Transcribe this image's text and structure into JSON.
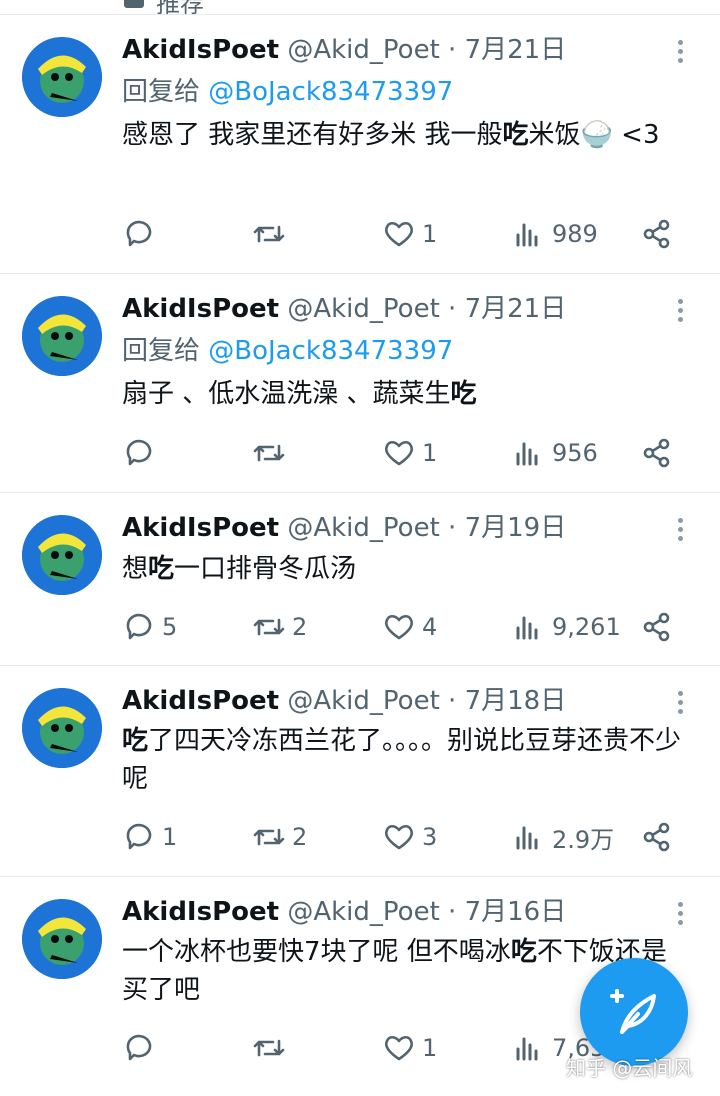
{
  "top": {
    "label": "推荐"
  },
  "tweets": [
    {
      "name": "AkidIsPoet",
      "handle": "@Akid_Poet",
      "sep": " · ",
      "date": "7月21日",
      "reply_prefix": "回复给 ",
      "reply_to": "@BoJack83473397",
      "text_a": "感恩了 我家里还有好多米 我一般",
      "text_bold": "吃",
      "text_b": "米饭🍚 <3",
      "replies": "",
      "retweets": "",
      "likes": "1",
      "views": "989"
    },
    {
      "name": "AkidIsPoet",
      "handle": "@Akid_Poet",
      "sep": " · ",
      "date": "7月21日",
      "reply_prefix": "回复给 ",
      "reply_to": "@BoJack83473397",
      "text_a": "扇子 、低水温洗澡 、蔬菜生",
      "text_bold": "吃",
      "text_b": "",
      "replies": "",
      "retweets": "",
      "likes": "1",
      "views": "956"
    },
    {
      "name": "AkidIsPoet",
      "handle": "@Akid_Poet",
      "sep": " · ",
      "date": "7月19日",
      "reply_prefix": "",
      "reply_to": "",
      "text_a": "想",
      "text_bold": "吃",
      "text_b": "一口排骨冬瓜汤",
      "replies": "5",
      "retweets": "2",
      "likes": "4",
      "views": "9,261"
    },
    {
      "name": "AkidIsPoet",
      "handle": "@Akid_Poet",
      "sep": " · ",
      "date": "7月18日",
      "reply_prefix": "",
      "reply_to": "",
      "text_a": "",
      "text_bold": "吃",
      "text_b": "了四天冷冻西兰花了。。。。别说比豆芽还贵不少呢",
      "replies": "1",
      "retweets": "2",
      "likes": "3",
      "views": "2.9万"
    },
    {
      "name": "AkidIsPoet",
      "handle": "@Akid_Poet",
      "sep": " · ",
      "date": "7月16日",
      "reply_prefix": "",
      "reply_to": "",
      "text_a": "一个冰杯也要快7块了呢 但不喝冰",
      "text_bold": "吃",
      "text_b": "不下饭还是买了吧",
      "replies": "",
      "retweets": "",
      "likes": "1",
      "views": "7,65…"
    }
  ],
  "watermark": "知乎 @云间风",
  "colors": {
    "accent": "#1d9bf0",
    "muted": "#536471",
    "text": "#0f1419"
  }
}
